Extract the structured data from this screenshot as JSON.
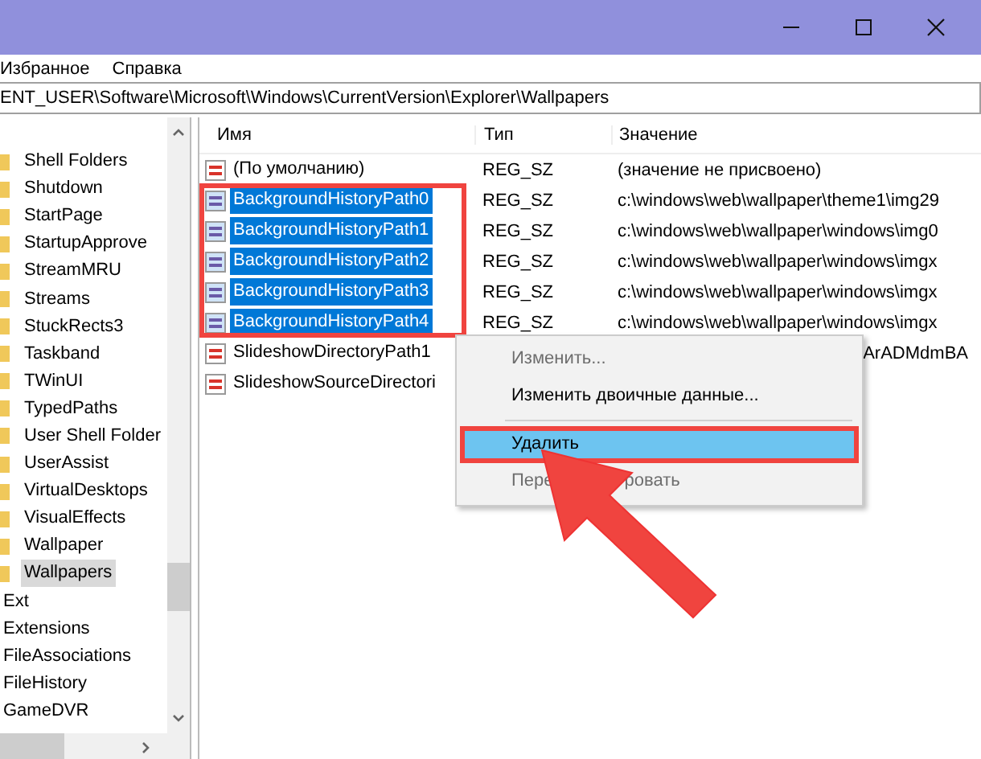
{
  "menu": [
    "Избранное",
    "Справка"
  ],
  "address": "ENT_USER\\Software\\Microsoft\\Windows\\CurrentVersion\\Explorer\\Wallpapers",
  "tree": {
    "items": [
      {
        "children": [
          {
            "label": "Shell Folders",
            "selected": false
          },
          {
            "label": "Shutdown",
            "selected": false
          },
          {
            "label": "StartPage",
            "selected": false
          },
          {
            "label": "StartupApprove",
            "selected": false
          },
          {
            "label": "StreamMRU",
            "selected": false
          },
          {
            "label": "Streams",
            "selected": false
          },
          {
            "label": "StuckRects3",
            "selected": false
          },
          {
            "label": "Taskband",
            "selected": false
          },
          {
            "label": "TWinUI",
            "selected": false
          },
          {
            "label": "TypedPaths",
            "selected": false
          },
          {
            "label": "User Shell Folder",
            "selected": false
          },
          {
            "label": "UserAssist",
            "selected": false
          },
          {
            "label": "VirtualDesktops",
            "selected": false
          },
          {
            "label": "VisualEffects",
            "selected": false
          },
          {
            "label": "Wallpaper",
            "selected": false
          },
          {
            "label": "Wallpapers",
            "selected": true
          }
        ]
      },
      {
        "label": "Ext",
        "selected": false
      },
      {
        "label": "Extensions",
        "selected": false
      },
      {
        "label": "FileAssociations",
        "selected": false
      },
      {
        "label": "FileHistory",
        "selected": false
      },
      {
        "label": "GameDVR",
        "selected": false
      }
    ]
  },
  "list": {
    "columns": [
      "Имя",
      "Тип",
      "Значение"
    ],
    "rows": [
      {
        "name": "(По умолчанию)",
        "type": "REG_SZ",
        "value": "(значение не присвоено)",
        "selected": false,
        "covered": false
      },
      {
        "name": "BackgroundHistoryPath0",
        "type": "REG_SZ",
        "value": "c:\\windows\\web\\wallpaper\\theme1\\img29",
        "selected": true,
        "covered": false
      },
      {
        "name": "BackgroundHistoryPath1",
        "type": "REG_SZ",
        "value": "c:\\windows\\web\\wallpaper\\windows\\img0",
        "selected": true,
        "covered": false
      },
      {
        "name": "BackgroundHistoryPath2",
        "type": "REG_SZ",
        "value": "c:\\windows\\web\\wallpaper\\windows\\imgx",
        "selected": true,
        "covered": false
      },
      {
        "name": "BackgroundHistoryPath3",
        "type": "REG_SZ",
        "value": "c:\\windows\\web\\wallpaper\\windows\\imgx",
        "selected": true,
        "covered": false
      },
      {
        "name": "BackgroundHistoryPath4",
        "type": "REG_SZ",
        "value": "c:\\windows\\web\\wallpaper\\windows\\imgx",
        "selected": true,
        "covered": false
      },
      {
        "name": "SlideshowDirectoryPath1",
        "value": "ArADMdmBA",
        "selected": false,
        "covered": true
      },
      {
        "name": "SlideshowSourceDirectori",
        "selected": false
      }
    ]
  },
  "context_menu": {
    "items": [
      {
        "kind": "item",
        "label": "Изменить...",
        "disabled": true,
        "selected": false
      },
      {
        "kind": "item",
        "label": "Изменить двоичные данные...",
        "disabled": false,
        "selected": false
      },
      {
        "kind": "separator"
      },
      {
        "kind": "item",
        "label": "Удалить",
        "disabled": false,
        "selected": true
      },
      {
        "kind": "item",
        "label_parts": [
          "Пере",
          "ровать"
        ],
        "disabled": true,
        "selected": false
      }
    ]
  }
}
